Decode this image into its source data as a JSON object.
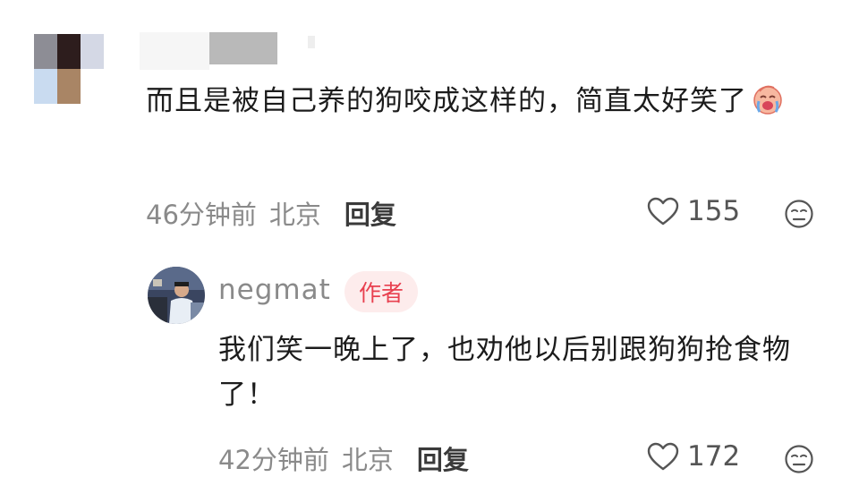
{
  "comment1": {
    "text": "而且是被自己养的狗咬成这样的，简直太好笑了",
    "emoji": "crying-laughing-face-icon",
    "time": "46分钟前",
    "location": "北京",
    "reply_label": "回复",
    "likes": "155"
  },
  "comment2": {
    "username": "negmat",
    "badge": "作者",
    "text": "我们笑一晚上了，也劝他以后别跟狗狗抢食物了！",
    "time": "42分钟前",
    "location": "北京",
    "reply_label": "回复",
    "likes": "172"
  },
  "colors": {
    "badge_bg": "#fdecec",
    "badge_text": "#e8404f",
    "meta_text": "#8a8a8a"
  }
}
